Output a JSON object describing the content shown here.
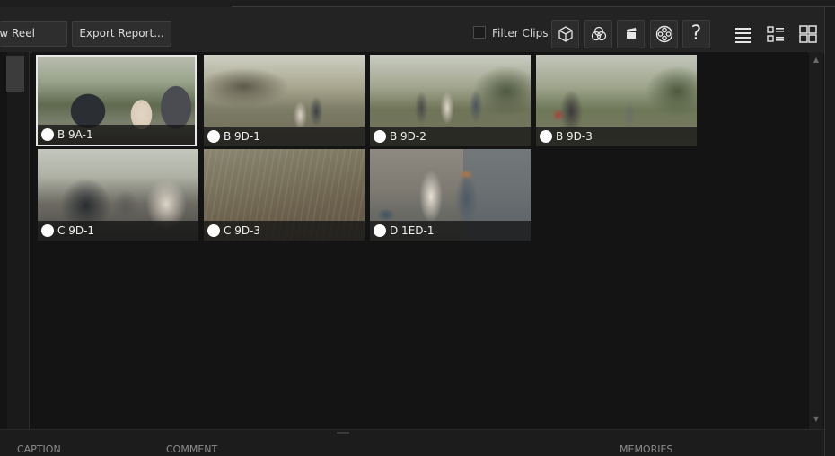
{
  "toolbar": {
    "new_reel_label": "ew Reel",
    "export_label": "Export Report...",
    "filter_label": "Filter Clips",
    "filter_checked": false,
    "help_glyph": "?",
    "icons": [
      "cube-icon",
      "color-circles-icon",
      "clapperboard-icon",
      "film-reel-icon",
      "help-icon",
      "list-view-icon",
      "detail-view-icon",
      "grid-view-icon"
    ]
  },
  "clips": [
    {
      "label": "B 9A-1",
      "selected": true
    },
    {
      "label": "B 9D-1",
      "selected": false
    },
    {
      "label": "B 9D-2",
      "selected": false
    },
    {
      "label": "B 9D-3",
      "selected": false
    },
    {
      "label": "C 9D-1",
      "selected": false
    },
    {
      "label": "C 9D-3",
      "selected": false
    },
    {
      "label": "D 1ED-1",
      "selected": false
    }
  ],
  "scrollbar": {
    "up": "▲",
    "down": "▼"
  },
  "footer": {
    "caption": "CAPTION",
    "comment": "COMMENT",
    "memories": "MEMORIES"
  },
  "colors": {
    "background": "#121212",
    "toolbar": "#232323",
    "selection_border": "#e8e8e8",
    "dot": "#ffffff"
  }
}
